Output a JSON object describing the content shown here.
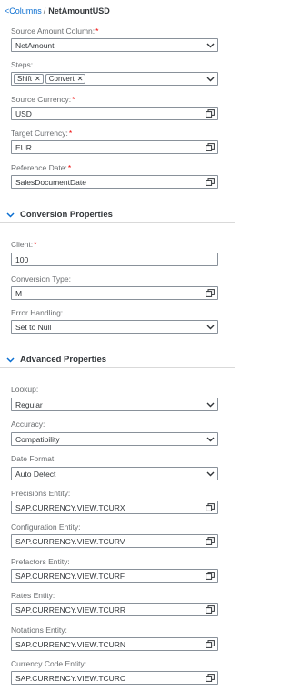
{
  "breadcrumb": {
    "link": "<Columns",
    "separator": "/",
    "current": "NetAmountUSD"
  },
  "fields": {
    "source_amount_column": {
      "label": "Source Amount Column:",
      "required": "*",
      "value": "NetAmount"
    },
    "steps": {
      "label": "Steps:",
      "tokens": [
        "Shift",
        "Convert"
      ]
    },
    "source_currency": {
      "label": "Source Currency:",
      "required": "*",
      "value": "USD"
    },
    "target_currency": {
      "label": "Target Currency:",
      "required": "*",
      "value": "EUR"
    },
    "reference_date": {
      "label": "Reference Date:",
      "required": "*",
      "value": "SalesDocumentDate"
    }
  },
  "conversion_properties": {
    "title": "Conversion Properties",
    "client": {
      "label": "Client:",
      "required": "*",
      "value": "100"
    },
    "conversion_type": {
      "label": "Conversion Type:",
      "value": "M"
    },
    "error_handling": {
      "label": "Error Handling:",
      "value": "Set to Null"
    }
  },
  "advanced_properties": {
    "title": "Advanced Properties",
    "lookup": {
      "label": "Lookup:",
      "value": "Regular"
    },
    "accuracy": {
      "label": "Accuracy:",
      "value": "Compatibility"
    },
    "date_format": {
      "label": "Date Format:",
      "value": "Auto Detect"
    },
    "precisions_entity": {
      "label": "Precisions Entity:",
      "value": "SAP.CURRENCY.VIEW.TCURX"
    },
    "configuration_entity": {
      "label": "Configuration Entity:",
      "value": "SAP.CURRENCY.VIEW.TCURV"
    },
    "prefactors_entity": {
      "label": "Prefactors Entity:",
      "value": "SAP.CURRENCY.VIEW.TCURF"
    },
    "rates_entity": {
      "label": "Rates Entity:",
      "value": "SAP.CURRENCY.VIEW.TCURR"
    },
    "notations_entity": {
      "label": "Notations Entity:",
      "value": "SAP.CURRENCY.VIEW.TCURN"
    },
    "currency_code_entity": {
      "label": "Currency Code Entity:",
      "value": "SAP.CURRENCY.VIEW.TCURC"
    }
  },
  "icons": {
    "dropdown": "chevron-down-icon",
    "value_help": "value-help-icon",
    "section_toggle": "chevron-down-icon",
    "token_remove": "close-icon"
  },
  "colors": {
    "link": "#0a6ed1",
    "required": "#e00000",
    "text": "#32363a",
    "label": "#6a6d70",
    "border": "#89919a"
  }
}
